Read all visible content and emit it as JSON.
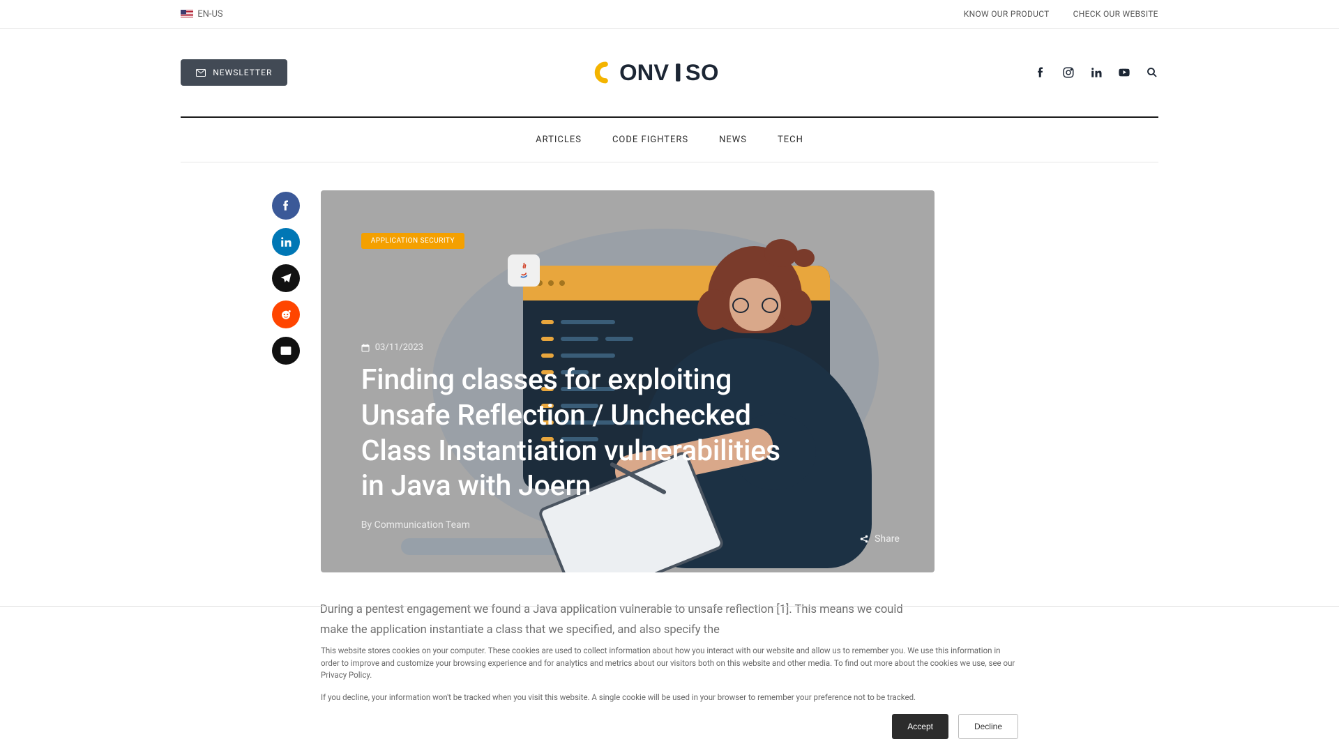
{
  "topbar": {
    "lang": "EN-US",
    "links": {
      "product": "KNOW OUR PRODUCT",
      "website": "CHECK OUR WEBSITE"
    }
  },
  "header": {
    "newsletter": "NEWSLETTER",
    "logo": {
      "brand": "CONVISO"
    }
  },
  "nav": {
    "articles": "ARTICLES",
    "code_fighters": "CODE FIGHTERS",
    "news": "NEWS",
    "tech": "TECH"
  },
  "hero": {
    "tag": "APPLICATION SECURITY",
    "date": "03/11/2023",
    "title": "Finding classes for exploiting Unsafe Reflection / Unchecked Class Instantiation vulnerabilities in Java with Joern",
    "by_prefix": "By ",
    "author": "Communication Team",
    "share": "Share"
  },
  "article": {
    "body": "During a pentest engagement we found a Java application vulnerable to unsafe reflection [1]. This means we could make the application instantiate a class that we specified, and also specify the"
  },
  "cookie": {
    "p1": "This website stores cookies on your computer. These cookies are used to collect information about how you interact with our website and allow us to remember you. We use this information in order to improve and customize your browsing experience and for analytics and metrics about our visitors both on this website and other media. To find out more about the cookies we use, see our Privacy Policy.",
    "p2": "If you decline, your information won't be tracked when you visit this website. A single cookie will be used in your browser to remember your preference not to be tracked.",
    "accept": "Accept",
    "decline": "Decline"
  }
}
